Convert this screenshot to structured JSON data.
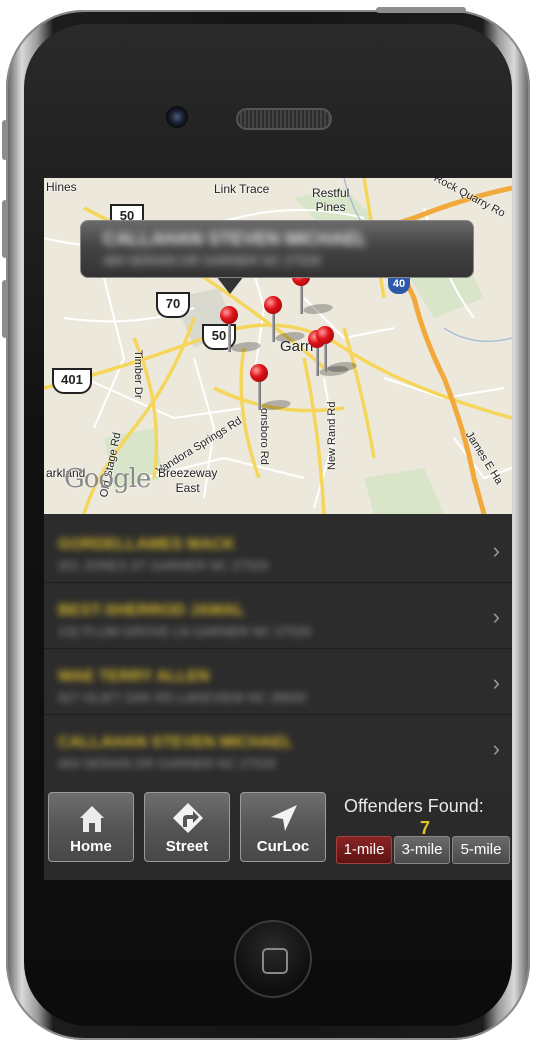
{
  "map": {
    "labels": {
      "hines": "Hines",
      "link_trace": "Link Trace",
      "restful_pines": "Restful\nPines",
      "rock_quarry": "Rock Quarry Ro",
      "us50_top": "50",
      "us70": "70",
      "us50_mid": "50",
      "us401": "401",
      "i40": "40",
      "garner": "Garn",
      "timber_dr": "Timber Dr",
      "vandora": "Vandora Springs Rd",
      "new_rand": "New Rand Rd",
      "old_stage": "Old Stage Rd",
      "breezeway": "Breezeway\nEast",
      "arkland": "arkland",
      "james_e": "James E Ha",
      "benson_rd": "onsboro Rd"
    },
    "google_logo": "Google",
    "callout": {
      "name": "CALLAHAN STEVEN MICHAEL",
      "address": "464 SERAIN DR GARNER NC 27529"
    }
  },
  "offenders": [
    {
      "name": "GORDELLAMES MACK",
      "address": "201 JONES ST GARNER NC 27529"
    },
    {
      "name": "BEST-SHERROD JAMAL",
      "address": "132 FLUM GROVE LN GARNER NC 27529"
    },
    {
      "name": "WAE TERRY ALLEN",
      "address": "927 OLIET OAK RD LAKEVIEW NC 28000"
    },
    {
      "name": "CALLAHAN STEVEN MICHAEL",
      "address": "464 SERAIN DR GARNER NC 27529"
    }
  ],
  "toolbar": {
    "home_label": "Home",
    "street_label": "Street",
    "curloc_label": "CurLoc",
    "found_label": "Offenders Found:",
    "found_count": "7",
    "radius": [
      "1-mile",
      "3-mile",
      "5-mile"
    ],
    "active_radius": "1-mile"
  },
  "icons": {
    "home": "house-icon",
    "street": "turn-arrow-icon",
    "curloc": "location-arrow-icon",
    "chevron": "chevron-right-icon"
  },
  "colors": {
    "accent_gold": "#e6c32a",
    "active_radius": "#8a2424",
    "pin": "#e0141a"
  }
}
